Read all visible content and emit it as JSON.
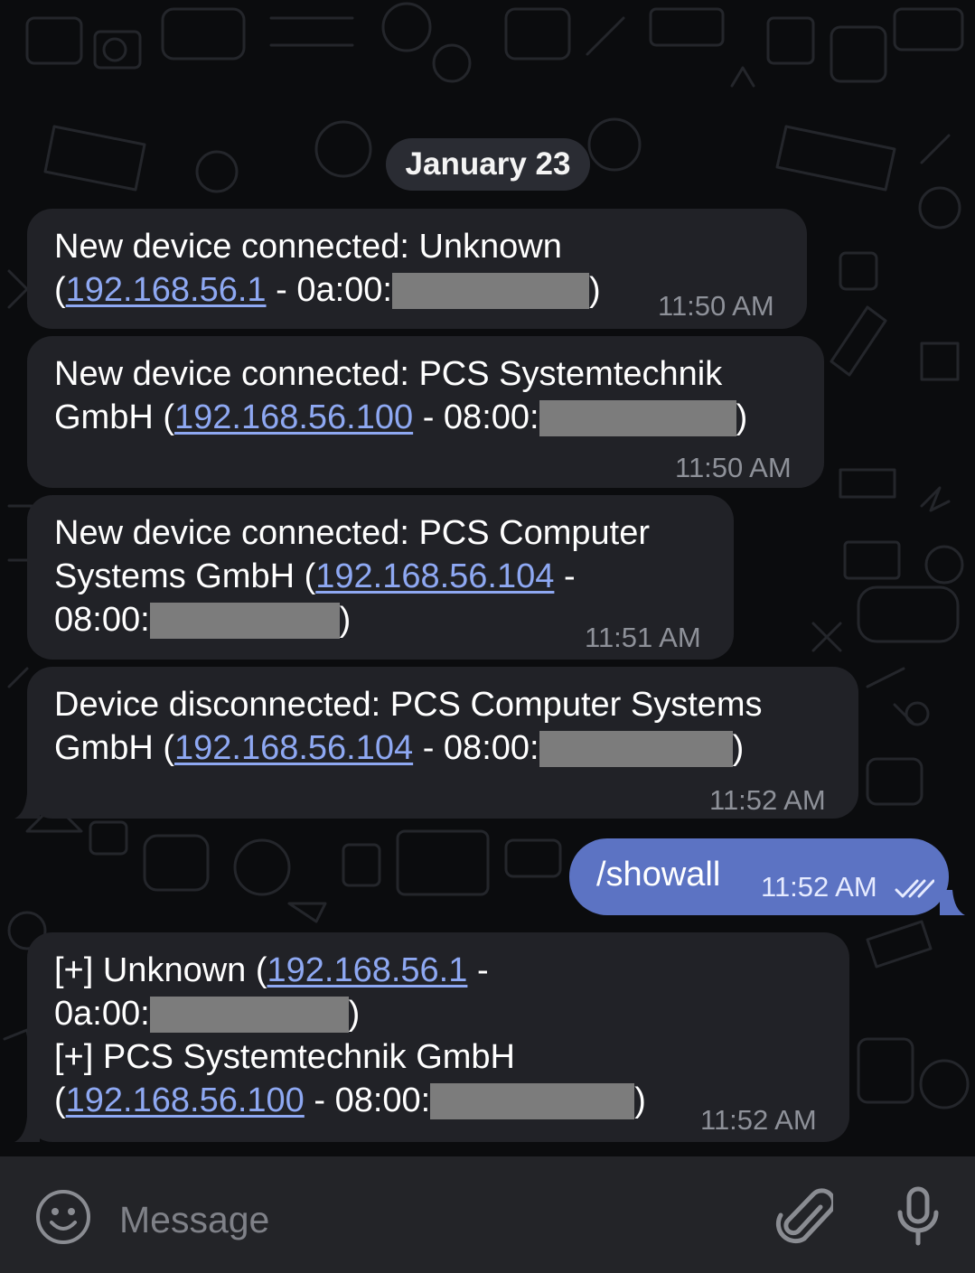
{
  "date_separator": "January 23",
  "messages": [
    {
      "direction": "incoming",
      "lines": [
        {
          "text": "New device connected: Unknown"
        },
        {
          "pre": "(",
          "ip": "192.168.56.1",
          "mid": " - 0a:00:",
          "post": ")"
        }
      ],
      "time": "11:50 AM"
    },
    {
      "direction": "incoming",
      "lines": [
        {
          "text": "New device connected: PCS Systemtechnik"
        },
        {
          "pre": "GmbH (",
          "ip": "192.168.56.100",
          "mid": " - 08:00:",
          "post": ")"
        }
      ],
      "time": "11:50 AM"
    },
    {
      "direction": "incoming",
      "lines": [
        {
          "text": "New device connected: PCS Computer"
        },
        {
          "pre": "Systems GmbH (",
          "ip": "192.168.56.104",
          "mid": " -"
        },
        {
          "pre": "08:00:",
          "post": ")"
        }
      ],
      "time": "11:51 AM"
    },
    {
      "direction": "incoming",
      "lines": [
        {
          "text": "Device disconnected: PCS Computer Systems"
        },
        {
          "pre": "GmbH (",
          "ip": "192.168.56.104",
          "mid": " - 08:00:",
          "post": ")"
        }
      ],
      "time": "11:52 AM"
    },
    {
      "direction": "outgoing",
      "text": "/showall",
      "time": "11:52 AM",
      "status_icon": "double-check-icon"
    },
    {
      "direction": "incoming",
      "lines": [
        {
          "pre": "[+] Unknown (",
          "ip": "192.168.56.1",
          "mid": " -"
        },
        {
          "pre": "0a:00:",
          "post": ")"
        },
        {
          "text": "[+] PCS Systemtechnik GmbH"
        },
        {
          "pre": "(",
          "ip": "192.168.56.100",
          "mid": " - 08:00:",
          "post": ")"
        }
      ],
      "time": "11:52 AM"
    }
  ],
  "composer": {
    "placeholder": "Message",
    "emoji_icon": "smiley-icon",
    "attach_icon": "paperclip-icon",
    "mic_icon": "microphone-icon"
  },
  "colors": {
    "background": "#0b0c0e",
    "incoming_bubble": "#212227",
    "outgoing_bubble": "#5c73c3",
    "link": "#8ea8f2",
    "timestamp": "#8e9199",
    "redaction": "#7c7c7c"
  }
}
